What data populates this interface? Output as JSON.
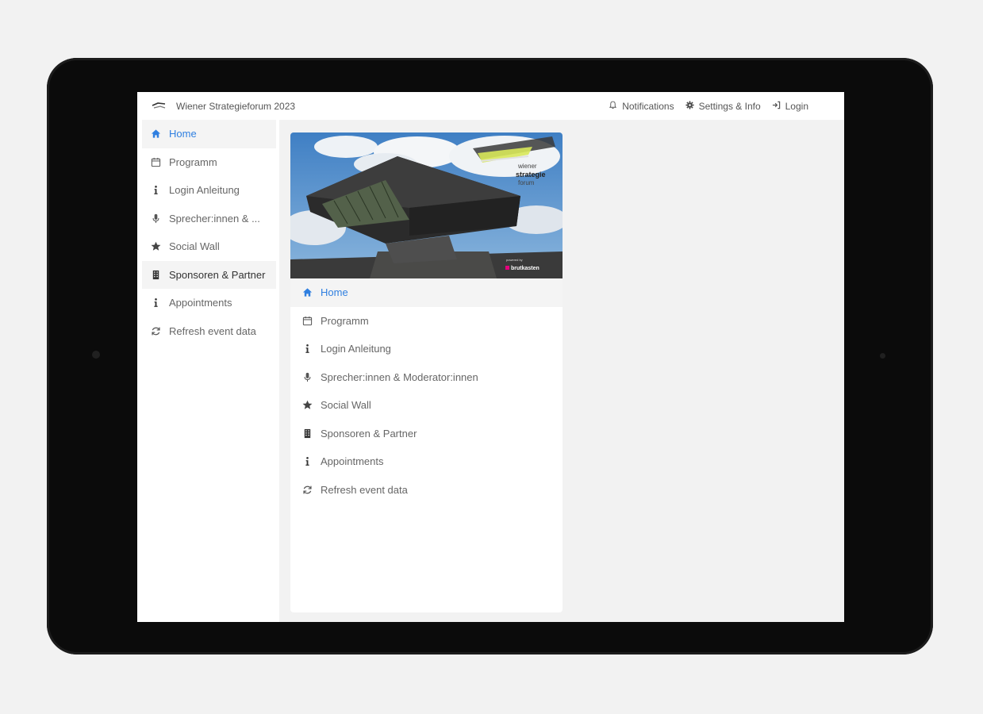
{
  "app": {
    "title": "Wiener Strategieforum 2023"
  },
  "topbar": {
    "actions": [
      {
        "label": "Notifications",
        "icon": "bell-icon"
      },
      {
        "label": "Settings & Info",
        "icon": "gear-icon"
      },
      {
        "label": "Login",
        "icon": "login-icon"
      }
    ]
  },
  "sidebar": {
    "items": [
      {
        "label": "Home",
        "icon": "home-icon",
        "active": true
      },
      {
        "label": "Programm",
        "icon": "calendar-icon"
      },
      {
        "label": "Login Anleitung",
        "icon": "info-icon"
      },
      {
        "label": "Sprecher:innen & ...",
        "icon": "microphone-icon"
      },
      {
        "label": "Social Wall",
        "icon": "star-icon"
      },
      {
        "label": "Sponsoren & Partner",
        "icon": "building-icon"
      },
      {
        "label": "Appointments",
        "icon": "info-icon"
      },
      {
        "label": "Refresh event data",
        "icon": "refresh-icon"
      }
    ]
  },
  "card": {
    "banner": {
      "logo_lines": [
        "wiener",
        "strategie",
        "forum"
      ],
      "powered_by": "powered by",
      "brand": "brutkasten"
    },
    "items": [
      {
        "label": "Home",
        "icon": "home-icon",
        "active": true
      },
      {
        "label": "Programm",
        "icon": "calendar-icon"
      },
      {
        "label": "Login Anleitung",
        "icon": "info-icon"
      },
      {
        "label": "Sprecher:innen & Moderator:innen",
        "icon": "microphone-icon"
      },
      {
        "label": "Social Wall",
        "icon": "star-icon"
      },
      {
        "label": "Sponsoren & Partner",
        "icon": "building-icon"
      },
      {
        "label": "Appointments",
        "icon": "info-icon"
      },
      {
        "label": "Refresh event data",
        "icon": "refresh-icon"
      }
    ]
  },
  "colors": {
    "accent": "#2f7fe0",
    "text": "#666666",
    "brand_pink": "#e6007e"
  }
}
